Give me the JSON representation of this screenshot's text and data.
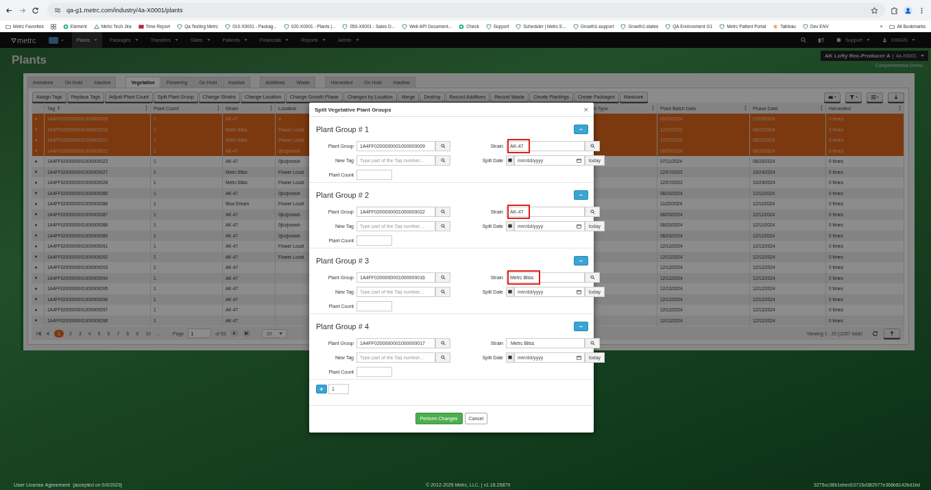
{
  "browser": {
    "url": "qa-g1.metrc.com/industry/4a-X0001/plants",
    "bookmarks": [
      {
        "label": "Metrc Favorites",
        "kind": "folder"
      },
      {
        "kind": "apps"
      },
      {
        "label": "Element",
        "kind": "dot"
      },
      {
        "label": "Metrc Tech Jira",
        "kind": "jira"
      },
      {
        "label": "Time Report",
        "kind": "report"
      },
      {
        "label": "Qa Testing Metrc",
        "kind": "shield"
      },
      {
        "label": "010-X0001 - Packag...",
        "kind": "shield"
      },
      {
        "label": "020-X0001 - Plants |...",
        "kind": "shield"
      },
      {
        "label": "050-X0001 - Sales D...",
        "kind": "shield"
      },
      {
        "label": "Web API Document...",
        "kind": "shield"
      },
      {
        "label": "Check",
        "kind": "dot"
      },
      {
        "label": "Support",
        "kind": "shield"
      },
      {
        "label": "Scheduler | Metrc E...",
        "kind": "shield"
      },
      {
        "label": "Growth1-support",
        "kind": "shield"
      },
      {
        "label": "Growth1-states",
        "kind": "shield"
      },
      {
        "label": "QA Environment G1",
        "kind": "shield"
      },
      {
        "label": "Metrc Patient Portal",
        "kind": "shield"
      },
      {
        "label": "Tableau",
        "kind": "tableau"
      },
      {
        "label": "Dev ENV",
        "kind": "shield"
      }
    ],
    "more": "»",
    "all_bookmarks": "All Bookmarks"
  },
  "nav": {
    "logo": "metrc",
    "items": [
      {
        "label": "Plants",
        "selected": true
      },
      {
        "label": "Packages",
        "selected": false
      },
      {
        "label": "Transfers",
        "selected": false
      },
      {
        "label": "Sales",
        "selected": false
      },
      {
        "label": "Patients",
        "selected": false
      },
      {
        "label": "Financials",
        "selected": false
      },
      {
        "label": "Reports",
        "selected": false
      },
      {
        "label": "Admin",
        "selected": false
      }
    ],
    "support": "Support",
    "user": "X00420"
  },
  "page": {
    "title": "Plants",
    "facility": "AK Lofty Rec-Producer A",
    "facility_separator": "|",
    "facility_code": "4a-X0001",
    "subtitle": "Comprehensive Demo"
  },
  "tab_groups": [
    [
      {
        "label": "Immature",
        "selected": false
      },
      {
        "label": "On Hold",
        "selected": false
      },
      {
        "label": "Inactive",
        "selected": false
      }
    ],
    [
      {
        "label": "Vegetative",
        "selected": true
      },
      {
        "label": "Flowering",
        "selected": false
      },
      {
        "label": "On Hold",
        "selected": false
      },
      {
        "label": "Inactive",
        "selected": false
      }
    ],
    [
      {
        "label": "Additives",
        "selected": false
      },
      {
        "label": "Waste",
        "selected": false
      }
    ],
    [
      {
        "label": "Harvested",
        "selected": false
      },
      {
        "label": "On Hold",
        "selected": false
      },
      {
        "label": "Inactive",
        "selected": false
      }
    ]
  ],
  "actions": [
    "Assign Tags",
    "Replace Tags",
    "Adjust Plant Count",
    "Split Plant Group",
    "Change Strains",
    "Change Location",
    "Change Growth Phase",
    "Changes by Location",
    "Merge",
    "Destroy",
    "Record Additives",
    "Record Waste",
    "Create Plantings",
    "Create Packages",
    "Manicure"
  ],
  "table": {
    "columns": [
      "Tag",
      "Plant Count",
      "Strain",
      "Location",
      "h Type",
      "Plant Batch Date",
      "Phase Date",
      "Harvested"
    ],
    "rows": [
      {
        "cells": [
          "1A4FF0200000001000000009",
          "1",
          "AK-47",
          "a",
          "",
          "06/20/2024",
          "07/09/2024",
          "0 times"
        ],
        "selected": true
      },
      {
        "cells": [
          "1A4FF0200000001000000016",
          "1",
          "Metrc Bliss",
          "Flower Locat",
          "",
          "12/07/2022",
          "08/20/2024",
          "0 times"
        ],
        "selected": true
      },
      {
        "cells": [
          "1A4FF0200000001000000017",
          "1",
          "Metrc Bliss",
          "Flower Locat",
          "",
          "12/07/2022",
          "08/20/2024",
          "0 times"
        ],
        "selected": true
      },
      {
        "cells": [
          "1A4FF0200000001000000022",
          "1",
          "AK-47",
          "0jiczjnxavb",
          "",
          "08/20/2024",
          "08/20/2024",
          "0 times"
        ],
        "selected": true
      },
      {
        "cells": [
          "1A4FF0200000001000000023",
          "1",
          "AK-47",
          "0jiczjnxavb",
          "",
          "07/11/2024",
          "08/20/2024",
          "0 times"
        ],
        "selected": false
      },
      {
        "cells": [
          "1A4FF0200000001000000027",
          "1",
          "Metrc Bliss",
          "Flower Locat",
          "",
          "12/07/2022",
          "10/24/2024",
          "0 times"
        ],
        "selected": false
      },
      {
        "cells": [
          "1A4FF0200000001000000028",
          "1",
          "Metrc Bliss",
          "Flower Locat",
          "",
          "12/07/2022",
          "10/24/2024",
          "0 times"
        ],
        "selected": false
      },
      {
        "cells": [
          "1A4FF0200000001000000085",
          "1",
          "AK-47",
          "0jiczjnxavb",
          "",
          "08/20/2024",
          "12/11/2024",
          "0 times"
        ],
        "selected": false
      },
      {
        "cells": [
          "1A4FF0200000001000000086",
          "1",
          "Blue Dream",
          "Flower Locat",
          "",
          "11/22/2024",
          "12/11/2024",
          "0 times"
        ],
        "selected": false
      },
      {
        "cells": [
          "1A4FF0200000001000000087",
          "1",
          "AK-47",
          "0jiczjnxavb",
          "",
          "08/20/2024",
          "12/11/2024",
          "0 times"
        ],
        "selected": false
      },
      {
        "cells": [
          "1A4FF0200000001000000088",
          "1",
          "AK-47",
          "0jiczjnxavb",
          "",
          "08/20/2024",
          "12/11/2024",
          "0 times"
        ],
        "selected": false
      },
      {
        "cells": [
          "1A4FF0200000001000000089",
          "1",
          "AK-47",
          "0jiczjnxavb",
          "",
          "08/20/2024",
          "12/11/2024",
          "0 times"
        ],
        "selected": false
      },
      {
        "cells": [
          "1A4FF0200000001000000091",
          "1",
          "AK-47",
          "Flower Locat",
          "",
          "12/12/2024",
          "12/12/2024",
          "0 times"
        ],
        "selected": false
      },
      {
        "cells": [
          "1A4FF0200000001000000092",
          "1",
          "AK-47",
          "Flower Locat",
          "",
          "12/12/2024",
          "12/12/2024",
          "0 times"
        ],
        "selected": false
      },
      {
        "cells": [
          "1A4FF0200000001000000093",
          "1",
          "AK-47",
          "",
          "",
          "12/12/2024",
          "12/12/2024",
          "0 times"
        ],
        "selected": false
      },
      {
        "cells": [
          "1A4FF0200000001000000094",
          "1",
          "AK-47",
          "",
          "",
          "12/12/2024",
          "12/12/2024",
          "0 times"
        ],
        "selected": false
      },
      {
        "cells": [
          "1A4FF0200000001000000095",
          "1",
          "AK-47",
          "",
          "",
          "12/12/2024",
          "12/12/2024",
          "0 times"
        ],
        "selected": false
      },
      {
        "cells": [
          "1A4FF0200000001000000096",
          "1",
          "AK-47",
          "",
          "",
          "12/12/2024",
          "12/12/2024",
          "0 times"
        ],
        "selected": false
      },
      {
        "cells": [
          "1A4FF0200000001000000097",
          "1",
          "AK-47",
          "",
          "",
          "12/12/2024",
          "12/12/2024",
          "0 times"
        ],
        "selected": false
      },
      {
        "cells": [
          "1A4FF0200000001000000098",
          "1",
          "AK-47",
          "",
          "",
          "12/12/2024",
          "12/12/2024",
          "0 times"
        ],
        "selected": false
      }
    ]
  },
  "pager": {
    "pages": [
      {
        "label": "1",
        "selected": true
      },
      {
        "label": "2",
        "selected": false
      },
      {
        "label": "3",
        "selected": false
      },
      {
        "label": "4",
        "selected": false
      },
      {
        "label": "5",
        "selected": false
      },
      {
        "label": "6",
        "selected": false
      },
      {
        "label": "7",
        "selected": false
      },
      {
        "label": "8",
        "selected": false
      },
      {
        "label": "9",
        "selected": false
      },
      {
        "label": "10",
        "selected": false
      }
    ],
    "ellipsis": "...",
    "page_label": "Page",
    "page_value": "1",
    "of": "of 53",
    "page_size": "20",
    "viewing": "Viewing 1 - 20 (1057 total)"
  },
  "footer": {
    "license": "User License Agreement",
    "accepted": "(accepted on 0/0/2023)",
    "copyright": "© 2012-2025 Metrc, LLC. | v1.18.25879",
    "build": "3275cc36b1ebed10715d382977e366b6142bd1bd"
  },
  "modal": {
    "title": "Split Vegetative Plant Groups",
    "close": "×",
    "groups": [
      {
        "heading": "Plant Group # 1",
        "plant_group_label": "Plant Group",
        "plant_group": "1A4FF0200000001000000009",
        "new_tag_label": "New Tag",
        "new_tag_placeholder": "Type part of the Tag number...",
        "plant_count_label": "Plant Count",
        "strain_label": "Strain",
        "strain": "AK-47",
        "highlighted": true,
        "split_date_label": "Split Date",
        "date_placeholder": "mm/dd/yyyy",
        "today": "today",
        "remove": "−"
      },
      {
        "heading": "Plant Group # 2",
        "plant_group_label": "Plant Group",
        "plant_group": "1A4FF0200000001000000022",
        "new_tag_label": "New Tag",
        "new_tag_placeholder": "Type part of the Tag number...",
        "plant_count_label": "Plant Count",
        "strain_label": "Strain",
        "strain": "AK-47",
        "highlighted": true,
        "split_date_label": "Split Date",
        "date_placeholder": "mm/dd/yyyy",
        "today": "today",
        "remove": "−"
      },
      {
        "heading": "Plant Group # 3",
        "plant_group_label": "Plant Group",
        "plant_group": "1A4FF0200000001000000016",
        "new_tag_label": "New Tag",
        "new_tag_placeholder": "Type part of the Tag number...",
        "plant_count_label": "Plant Count",
        "strain_label": "Strain",
        "strain": "Metrc Bliss",
        "highlighted": true,
        "split_date_label": "Split Date",
        "date_placeholder": "mm/dd/yyyy",
        "today": "today",
        "remove": "−"
      },
      {
        "heading": "Plant Group # 4",
        "plant_group_label": "Plant Group",
        "plant_group": "1A4FF0200000001000000017",
        "new_tag_label": "New Tag",
        "new_tag_placeholder": "Type part of the Tag number...",
        "plant_count_label": "Plant Count",
        "strain_label": "Strain",
        "strain": "Metrc Bliss",
        "highlighted": false,
        "split_date_label": "Split Date",
        "date_placeholder": "mm/dd/yyyy",
        "today": "today",
        "remove": "−"
      }
    ],
    "add_count": "1",
    "add": "+",
    "perform": "Perform Changes",
    "cancel": "Cancel"
  }
}
